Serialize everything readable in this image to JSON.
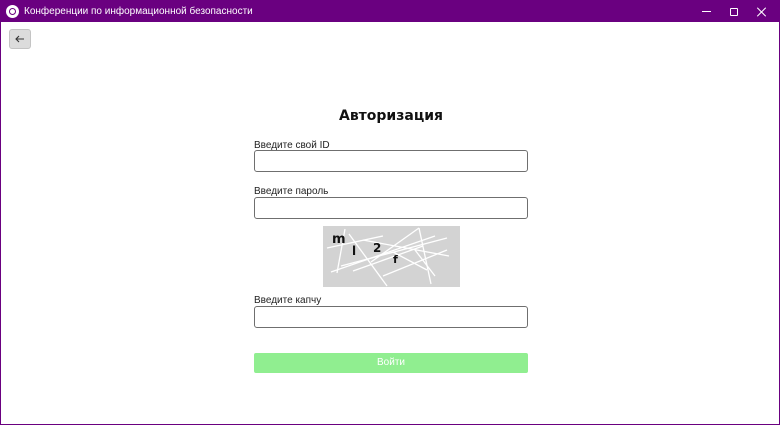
{
  "window": {
    "title": "Конференции по информационной безопасности",
    "accent_color": "#6a0080",
    "icons": {
      "app": "app-logo-icon",
      "minimize": "minimize-icon",
      "maximize": "maximize-icon",
      "close": "close-icon"
    }
  },
  "nav": {
    "back_icon": "arrow-left-icon"
  },
  "form": {
    "heading": "Авторизация",
    "id_label": "Введите свой ID",
    "id_value": "",
    "password_label": "Введите пароль",
    "password_value": "",
    "captcha": {
      "chars": [
        "m",
        "l",
        "2",
        "f"
      ],
      "background_color": "#d3d3d3"
    },
    "captcha_label": "Введите капчу",
    "captcha_value": "",
    "submit_label": "Войти",
    "submit_color": "#90ee90"
  }
}
